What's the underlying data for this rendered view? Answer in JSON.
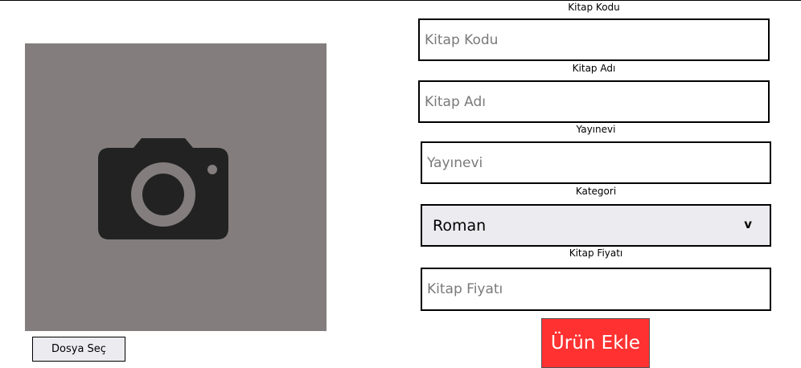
{
  "image_upload": {
    "icon": "camera-icon",
    "file_button_label": "Dosya Seç"
  },
  "form": {
    "code": {
      "label": "Kitap Kodu",
      "placeholder": "Kitap Kodu",
      "value": ""
    },
    "name": {
      "label": "Kitap Adı",
      "placeholder": "Kitap Adı",
      "value": ""
    },
    "publisher": {
      "label": "Yayınevi",
      "placeholder": "Yayınevi",
      "value": ""
    },
    "category": {
      "label": "Kategori",
      "selected": "Roman",
      "chevron": "v"
    },
    "price": {
      "label": "Kitap Fiyatı",
      "placeholder": "Kitap Fiyatı",
      "value": ""
    },
    "submit_label": "Ürün Ekle"
  },
  "colors": {
    "image_panel_bg": "#837d7d",
    "camera_icon": "#222222",
    "select_bg": "#ececf0",
    "submit_bg": "#ff3131",
    "submit_text": "#ffffff"
  }
}
